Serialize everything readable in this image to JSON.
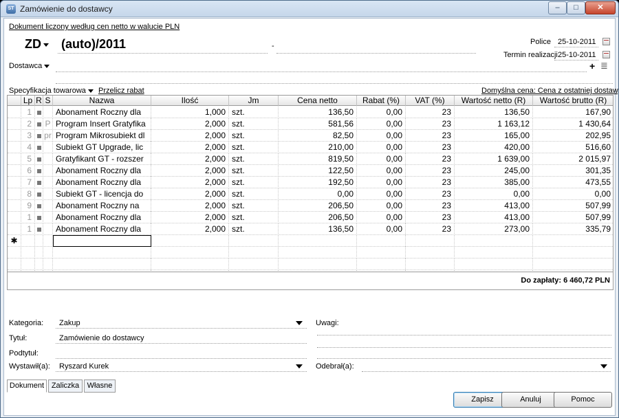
{
  "window": {
    "title": "Zamówienie do dostawcy",
    "app_icon": "ST",
    "minimize": "–",
    "maximize": "□",
    "close": "✕"
  },
  "header": {
    "price_note": "Dokument liczony według cen netto w walucie PLN",
    "doc_type": "ZD",
    "doc_number": "(auto)/2011",
    "separator": "-",
    "place_date_label": "Police",
    "place_date_value": "25-10-2011",
    "termin_label": "Termin realizacji",
    "termin_value": "25-10-2011",
    "supplier_label": "Dostawca",
    "plus_icon": "+",
    "list_icon": "≣"
  },
  "spec": {
    "label": "Specyfikacja towarowa",
    "recalc_label": "Przelicz rabat",
    "default_price": "Domyślna cena: Cena z ostatniej dostawy"
  },
  "table": {
    "columns": [
      "Lp",
      "R",
      "S",
      "Nazwa",
      "Ilość",
      "Jm",
      "Cena netto",
      "Rabat (%)",
      "VAT (%)",
      "Wartość netto (R)",
      "Wartość brutto (R)"
    ],
    "rows": [
      {
        "lp": "1",
        "s": "",
        "name": "Abonament Roczny dla",
        "qty": "1,000",
        "jm": "szt.",
        "price": "136,50",
        "disc": "0,00",
        "vat": "23",
        "net": "136,50",
        "gross": "167,90"
      },
      {
        "lp": "2",
        "s": "P",
        "name": "Program Insert Gratyfika",
        "qty": "2,000",
        "jm": "szt.",
        "price": "581,56",
        "disc": "0,00",
        "vat": "23",
        "net": "1 163,12",
        "gross": "1 430,64"
      },
      {
        "lp": "3",
        "s": "pr",
        "name": "Program Mikrosubiekt dl",
        "qty": "2,000",
        "jm": "szt.",
        "price": "82,50",
        "disc": "0,00",
        "vat": "23",
        "net": "165,00",
        "gross": "202,95"
      },
      {
        "lp": "4",
        "s": "",
        "name": "Subiekt GT Upgrade, lic",
        "qty": "2,000",
        "jm": "szt.",
        "price": "210,00",
        "disc": "0,00",
        "vat": "23",
        "net": "420,00",
        "gross": "516,60"
      },
      {
        "lp": "5",
        "s": "",
        "name": "Gratyfikant GT - rozszer",
        "qty": "2,000",
        "jm": "szt.",
        "price": "819,50",
        "disc": "0,00",
        "vat": "23",
        "net": "1 639,00",
        "gross": "2 015,97"
      },
      {
        "lp": "6",
        "s": "",
        "name": "Abonament Roczny dla",
        "qty": "2,000",
        "jm": "szt.",
        "price": "122,50",
        "disc": "0,00",
        "vat": "23",
        "net": "245,00",
        "gross": "301,35"
      },
      {
        "lp": "7",
        "s": "",
        "name": "Abonament Roczny dla",
        "qty": "2,000",
        "jm": "szt.",
        "price": "192,50",
        "disc": "0,00",
        "vat": "23",
        "net": "385,00",
        "gross": "473,55"
      },
      {
        "lp": "8",
        "s": "",
        "name": "Subiekt GT - licencja do",
        "qty": "2,000",
        "jm": "szt.",
        "price": "0,00",
        "disc": "0,00",
        "vat": "23",
        "net": "0,00",
        "gross": "0,00"
      },
      {
        "lp": "9",
        "s": "",
        "name": "Abonament Roczny na",
        "qty": "2,000",
        "jm": "szt.",
        "price": "206,50",
        "disc": "0,00",
        "vat": "23",
        "net": "413,00",
        "gross": "507,99"
      },
      {
        "lp": "1",
        "s": "",
        "name": "Abonament Roczny dla",
        "qty": "2,000",
        "jm": "szt.",
        "price": "206,50",
        "disc": "0,00",
        "vat": "23",
        "net": "413,00",
        "gross": "507,99"
      },
      {
        "lp": "1",
        "s": "",
        "name": "Abonament Roczny dla",
        "qty": "2,000",
        "jm": "szt.",
        "price": "136,50",
        "disc": "0,00",
        "vat": "23",
        "net": "273,00",
        "gross": "335,79"
      }
    ],
    "new_row_marker": "✱",
    "total": "Do zapłaty: 6 460,72 PLN"
  },
  "form": {
    "category_label": "Kategoria:",
    "category_value": "Zakup",
    "title_label": "Tytuł:",
    "title_value": "Zamówienie do dostawcy",
    "subtitle_label": "Podtytuł:",
    "issuer_label": "Wystawił(a):",
    "issuer_value": "Ryszard Kurek",
    "notes_label": "Uwagi:",
    "receiver_label": "Odebrał(a):"
  },
  "tabs": [
    "Dokument",
    "Zaliczka",
    "Własne"
  ],
  "buttons": {
    "save": "Zapisz",
    "cancel": "Anuluj",
    "help": "Pomoc"
  }
}
